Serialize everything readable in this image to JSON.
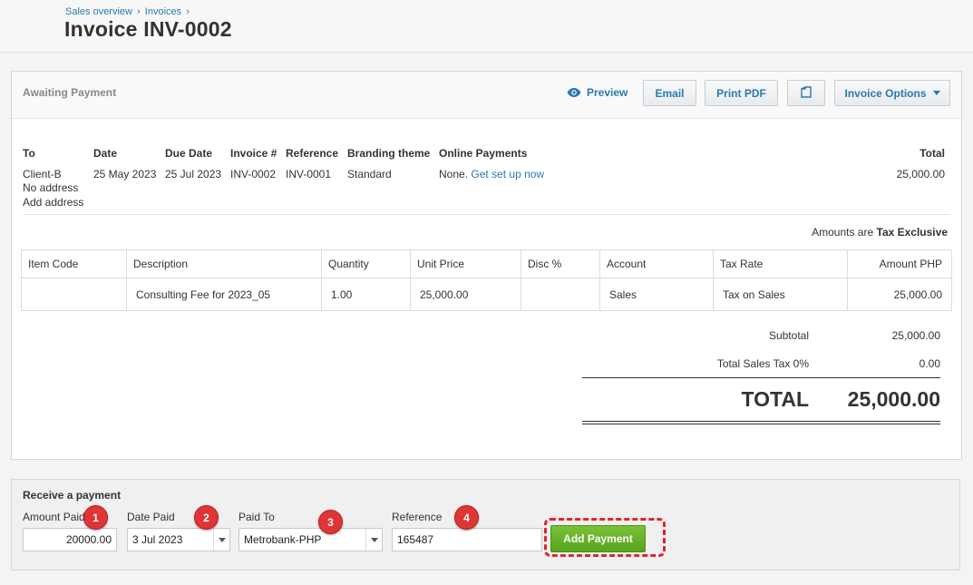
{
  "breadcrumb": {
    "items": [
      "Sales overview",
      "Invoices"
    ],
    "separator": "›"
  },
  "page_title": "Invoice INV-0002",
  "toolbar": {
    "status": "Awaiting Payment",
    "preview_label": "Preview",
    "email_label": "Email",
    "print_pdf_label": "Print PDF",
    "copy_icon": "copy-icon",
    "invoice_options_label": "Invoice Options"
  },
  "meta": {
    "headers": {
      "to": "To",
      "date": "Date",
      "due_date": "Due Date",
      "invoice_no": "Invoice #",
      "reference": "Reference",
      "branding": "Branding theme",
      "online": "Online Payments",
      "total": "Total"
    },
    "values": {
      "client": "Client-B",
      "no_address": "No address",
      "add_address": "Add address",
      "date": "25 May 2023",
      "due_date": "25 Jul 2023",
      "invoice_no": "INV-0002",
      "reference": "INV-0001",
      "branding": "Standard",
      "online_none": "None.",
      "online_setup": "Get set up now",
      "total": "25,000.00"
    }
  },
  "amounts_are": {
    "prefix": "Amounts are",
    "value": "Tax Exclusive"
  },
  "line_items": {
    "headers": [
      "Item Code",
      "Description",
      "Quantity",
      "Unit Price",
      "Disc %",
      "Account",
      "Tax Rate",
      "Amount PHP"
    ],
    "rows": [
      [
        "",
        "Consulting Fee for 2023_05",
        "1.00",
        "25,000.00",
        "",
        "Sales",
        "Tax on Sales",
        "25,000.00"
      ]
    ]
  },
  "totals": {
    "subtotal_label": "Subtotal",
    "subtotal": "25,000.00",
    "tax_label": "Total Sales Tax 0%",
    "tax": "0.00",
    "total_label": "TOTAL",
    "total": "25,000.00"
  },
  "payment": {
    "title": "Receive a payment",
    "amount_label": "Amount Paid",
    "amount_value": "20000.00",
    "date_label": "Date Paid",
    "date_value": "3 Jul 2023",
    "paid_to_label": "Paid To",
    "paid_to_value": "Metrobank-PHP",
    "reference_label": "Reference",
    "reference_value": "165487",
    "add_button": "Add Payment",
    "step_badges": [
      "1",
      "2",
      "3",
      "4"
    ]
  },
  "colors": {
    "link": "#2a7ab0",
    "add_payment": "#62b025",
    "badge": "#e03535",
    "highlight": "#e0252a"
  }
}
